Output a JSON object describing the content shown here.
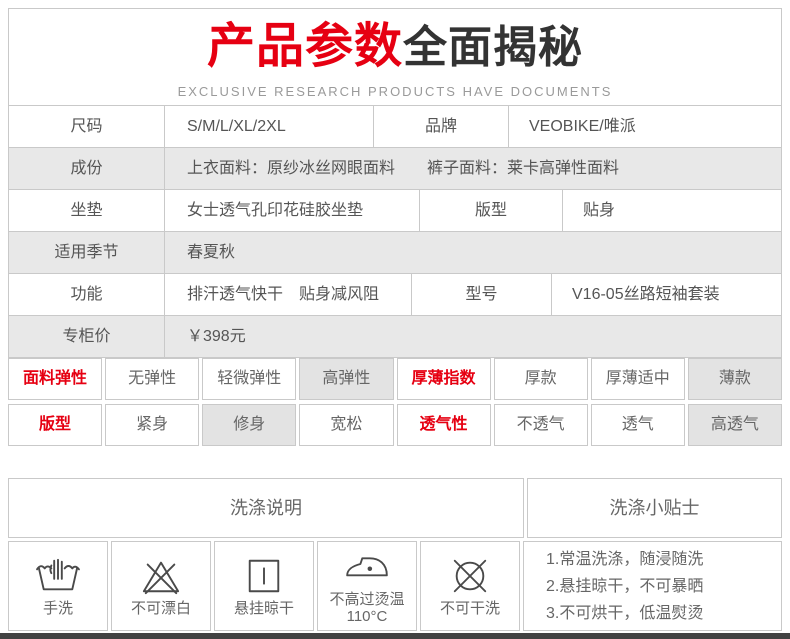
{
  "header": {
    "title_red": "产品参数",
    "title_dark": "全面揭秘",
    "subtitle": "EXCLUSIVE RESEARCH PRODUCTS HAVE DOCUMENTS"
  },
  "spec": {
    "rows": [
      {
        "label": "尺码",
        "value": "S/M/L/XL/2XL",
        "label2": "品牌",
        "value2": "VEOBIKE/唯派"
      },
      {
        "label": "成份",
        "value": "上衣面料：原纱冰丝网眼面料　　裤子面料：莱卡高弹性面料"
      },
      {
        "label": "坐垫",
        "value": "女士透气孔印花硅胶坐垫",
        "label2": "版型",
        "value2": "贴身"
      },
      {
        "label": "适用季节",
        "value": "春夏秋"
      },
      {
        "label": "功能",
        "value": "排汗透气快干　贴身减风阻",
        "label2": "型号",
        "value2": "V16-05丝路短袖套装"
      },
      {
        "label": "专柜价",
        "value": "￥398元"
      }
    ]
  },
  "attr": {
    "rows": [
      {
        "cells": [
          {
            "text": "面料弹性",
            "state": "label"
          },
          {
            "text": "无弹性",
            "state": "normal"
          },
          {
            "text": "轻微弹性",
            "state": "normal"
          },
          {
            "text": "高弹性",
            "state": "selected"
          },
          {
            "text": "厚薄指数",
            "state": "label"
          },
          {
            "text": "厚款",
            "state": "normal"
          },
          {
            "text": "厚薄适中",
            "state": "normal"
          },
          {
            "text": "薄款",
            "state": "selected"
          }
        ]
      },
      {
        "cells": [
          {
            "text": "版型",
            "state": "label"
          },
          {
            "text": "紧身",
            "state": "normal"
          },
          {
            "text": "修身",
            "state": "selected"
          },
          {
            "text": "宽松",
            "state": "normal"
          },
          {
            "text": "透气性",
            "state": "label"
          },
          {
            "text": "不透气",
            "state": "normal"
          },
          {
            "text": "透气",
            "state": "normal"
          },
          {
            "text": "高透气",
            "state": "selected"
          }
        ]
      }
    ]
  },
  "washing": {
    "section_title_left": "洗涤说明",
    "section_title_right": "洗涤小贴士",
    "icons": [
      {
        "icon": "hand-wash-icon",
        "label": "手洗"
      },
      {
        "icon": "no-bleach-icon",
        "label": "不可漂白"
      },
      {
        "icon": "hang-dry-icon",
        "label": "悬挂晾干"
      },
      {
        "icon": "iron-max-110-icon",
        "label": "不高过烫温",
        "label2": "110°C"
      },
      {
        "icon": "no-dry-clean-icon",
        "label": "不可干洗"
      }
    ],
    "tips": [
      "1.常温洗涤，随浸随洗",
      "2.悬挂晾干，不可暴晒",
      "3.不可烘干，低温熨烫"
    ]
  },
  "colors": {
    "accent_red": "#e60012",
    "title_dark": "#333333",
    "shaded_row_bg": "#e8e8e8",
    "selected_cell_bg": "#e3e3e3",
    "border": "#c9c9c9",
    "body_text": "#555555"
  }
}
